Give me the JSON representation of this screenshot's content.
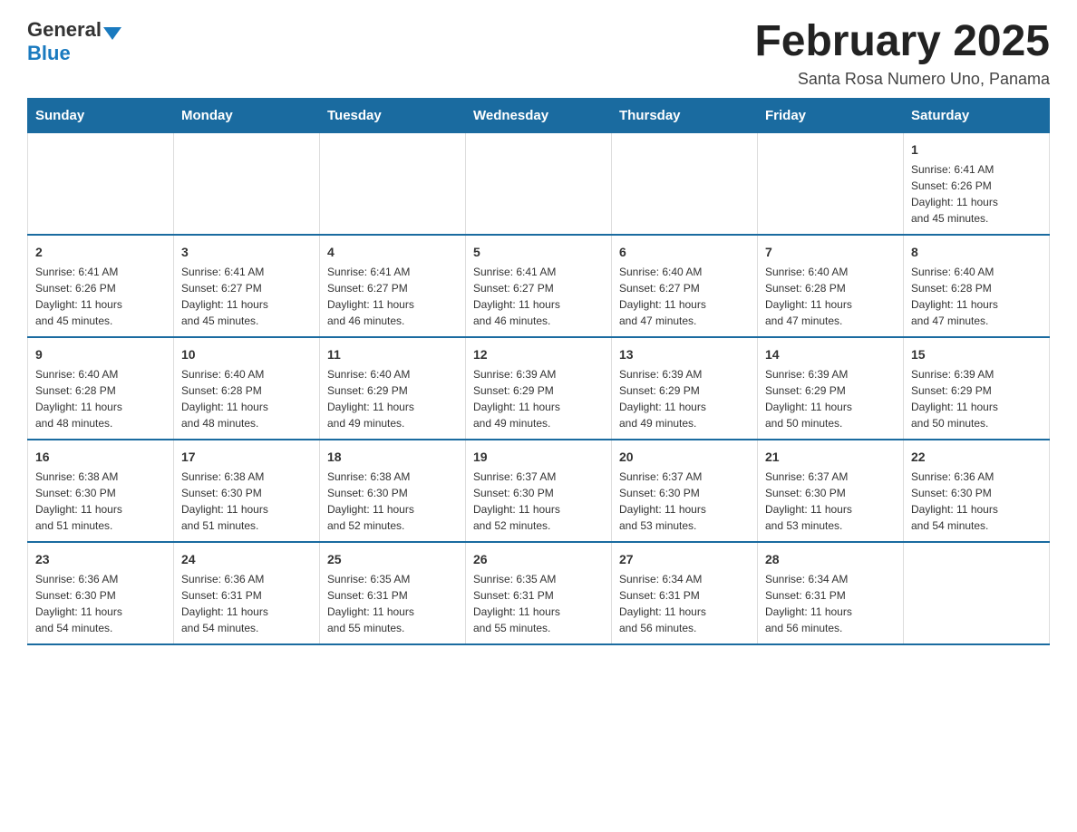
{
  "logo": {
    "general": "General",
    "blue": "Blue"
  },
  "header": {
    "title": "February 2025",
    "subtitle": "Santa Rosa Numero Uno, Panama"
  },
  "days_of_week": [
    "Sunday",
    "Monday",
    "Tuesday",
    "Wednesday",
    "Thursday",
    "Friday",
    "Saturday"
  ],
  "weeks": [
    [
      {
        "day": "",
        "info": ""
      },
      {
        "day": "",
        "info": ""
      },
      {
        "day": "",
        "info": ""
      },
      {
        "day": "",
        "info": ""
      },
      {
        "day": "",
        "info": ""
      },
      {
        "day": "",
        "info": ""
      },
      {
        "day": "1",
        "info": "Sunrise: 6:41 AM\nSunset: 6:26 PM\nDaylight: 11 hours\nand 45 minutes."
      }
    ],
    [
      {
        "day": "2",
        "info": "Sunrise: 6:41 AM\nSunset: 6:26 PM\nDaylight: 11 hours\nand 45 minutes."
      },
      {
        "day": "3",
        "info": "Sunrise: 6:41 AM\nSunset: 6:27 PM\nDaylight: 11 hours\nand 45 minutes."
      },
      {
        "day": "4",
        "info": "Sunrise: 6:41 AM\nSunset: 6:27 PM\nDaylight: 11 hours\nand 46 minutes."
      },
      {
        "day": "5",
        "info": "Sunrise: 6:41 AM\nSunset: 6:27 PM\nDaylight: 11 hours\nand 46 minutes."
      },
      {
        "day": "6",
        "info": "Sunrise: 6:40 AM\nSunset: 6:27 PM\nDaylight: 11 hours\nand 47 minutes."
      },
      {
        "day": "7",
        "info": "Sunrise: 6:40 AM\nSunset: 6:28 PM\nDaylight: 11 hours\nand 47 minutes."
      },
      {
        "day": "8",
        "info": "Sunrise: 6:40 AM\nSunset: 6:28 PM\nDaylight: 11 hours\nand 47 minutes."
      }
    ],
    [
      {
        "day": "9",
        "info": "Sunrise: 6:40 AM\nSunset: 6:28 PM\nDaylight: 11 hours\nand 48 minutes."
      },
      {
        "day": "10",
        "info": "Sunrise: 6:40 AM\nSunset: 6:28 PM\nDaylight: 11 hours\nand 48 minutes."
      },
      {
        "day": "11",
        "info": "Sunrise: 6:40 AM\nSunset: 6:29 PM\nDaylight: 11 hours\nand 49 minutes."
      },
      {
        "day": "12",
        "info": "Sunrise: 6:39 AM\nSunset: 6:29 PM\nDaylight: 11 hours\nand 49 minutes."
      },
      {
        "day": "13",
        "info": "Sunrise: 6:39 AM\nSunset: 6:29 PM\nDaylight: 11 hours\nand 49 minutes."
      },
      {
        "day": "14",
        "info": "Sunrise: 6:39 AM\nSunset: 6:29 PM\nDaylight: 11 hours\nand 50 minutes."
      },
      {
        "day": "15",
        "info": "Sunrise: 6:39 AM\nSunset: 6:29 PM\nDaylight: 11 hours\nand 50 minutes."
      }
    ],
    [
      {
        "day": "16",
        "info": "Sunrise: 6:38 AM\nSunset: 6:30 PM\nDaylight: 11 hours\nand 51 minutes."
      },
      {
        "day": "17",
        "info": "Sunrise: 6:38 AM\nSunset: 6:30 PM\nDaylight: 11 hours\nand 51 minutes."
      },
      {
        "day": "18",
        "info": "Sunrise: 6:38 AM\nSunset: 6:30 PM\nDaylight: 11 hours\nand 52 minutes."
      },
      {
        "day": "19",
        "info": "Sunrise: 6:37 AM\nSunset: 6:30 PM\nDaylight: 11 hours\nand 52 minutes."
      },
      {
        "day": "20",
        "info": "Sunrise: 6:37 AM\nSunset: 6:30 PM\nDaylight: 11 hours\nand 53 minutes."
      },
      {
        "day": "21",
        "info": "Sunrise: 6:37 AM\nSunset: 6:30 PM\nDaylight: 11 hours\nand 53 minutes."
      },
      {
        "day": "22",
        "info": "Sunrise: 6:36 AM\nSunset: 6:30 PM\nDaylight: 11 hours\nand 54 minutes."
      }
    ],
    [
      {
        "day": "23",
        "info": "Sunrise: 6:36 AM\nSunset: 6:30 PM\nDaylight: 11 hours\nand 54 minutes."
      },
      {
        "day": "24",
        "info": "Sunrise: 6:36 AM\nSunset: 6:31 PM\nDaylight: 11 hours\nand 54 minutes."
      },
      {
        "day": "25",
        "info": "Sunrise: 6:35 AM\nSunset: 6:31 PM\nDaylight: 11 hours\nand 55 minutes."
      },
      {
        "day": "26",
        "info": "Sunrise: 6:35 AM\nSunset: 6:31 PM\nDaylight: 11 hours\nand 55 minutes."
      },
      {
        "day": "27",
        "info": "Sunrise: 6:34 AM\nSunset: 6:31 PM\nDaylight: 11 hours\nand 56 minutes."
      },
      {
        "day": "28",
        "info": "Sunrise: 6:34 AM\nSunset: 6:31 PM\nDaylight: 11 hours\nand 56 minutes."
      },
      {
        "day": "",
        "info": ""
      }
    ]
  ]
}
